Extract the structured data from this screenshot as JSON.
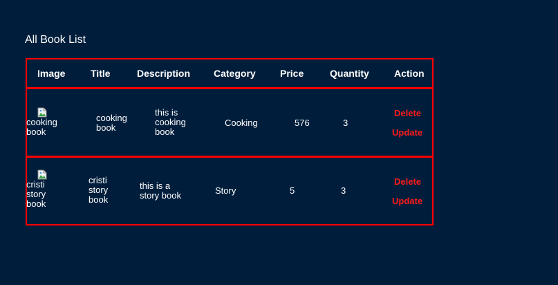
{
  "page": {
    "title": "All Book List"
  },
  "table": {
    "headers": {
      "image": "Image",
      "title": "Title",
      "description": "Description",
      "category": "Category",
      "price": "Price",
      "quantity": "Quantity",
      "action": "Action"
    },
    "rows": [
      {
        "image_alt": "cooking book",
        "title": "cooking book",
        "description": "this is cooking book",
        "category": "Cooking",
        "price": "576",
        "quantity": "3",
        "delete_label": "Delete",
        "update_label": "Update"
      },
      {
        "image_alt": "cristi story book",
        "title": "cristi story book",
        "description": "this is a story book",
        "category": "Story",
        "price": "5",
        "quantity": "3",
        "delete_label": "Delete",
        "update_label": "Update"
      }
    ]
  },
  "colors": {
    "background": "#001e3c",
    "border": "#ff0000",
    "action": "#ff1a1a",
    "text": "#ffffff"
  }
}
